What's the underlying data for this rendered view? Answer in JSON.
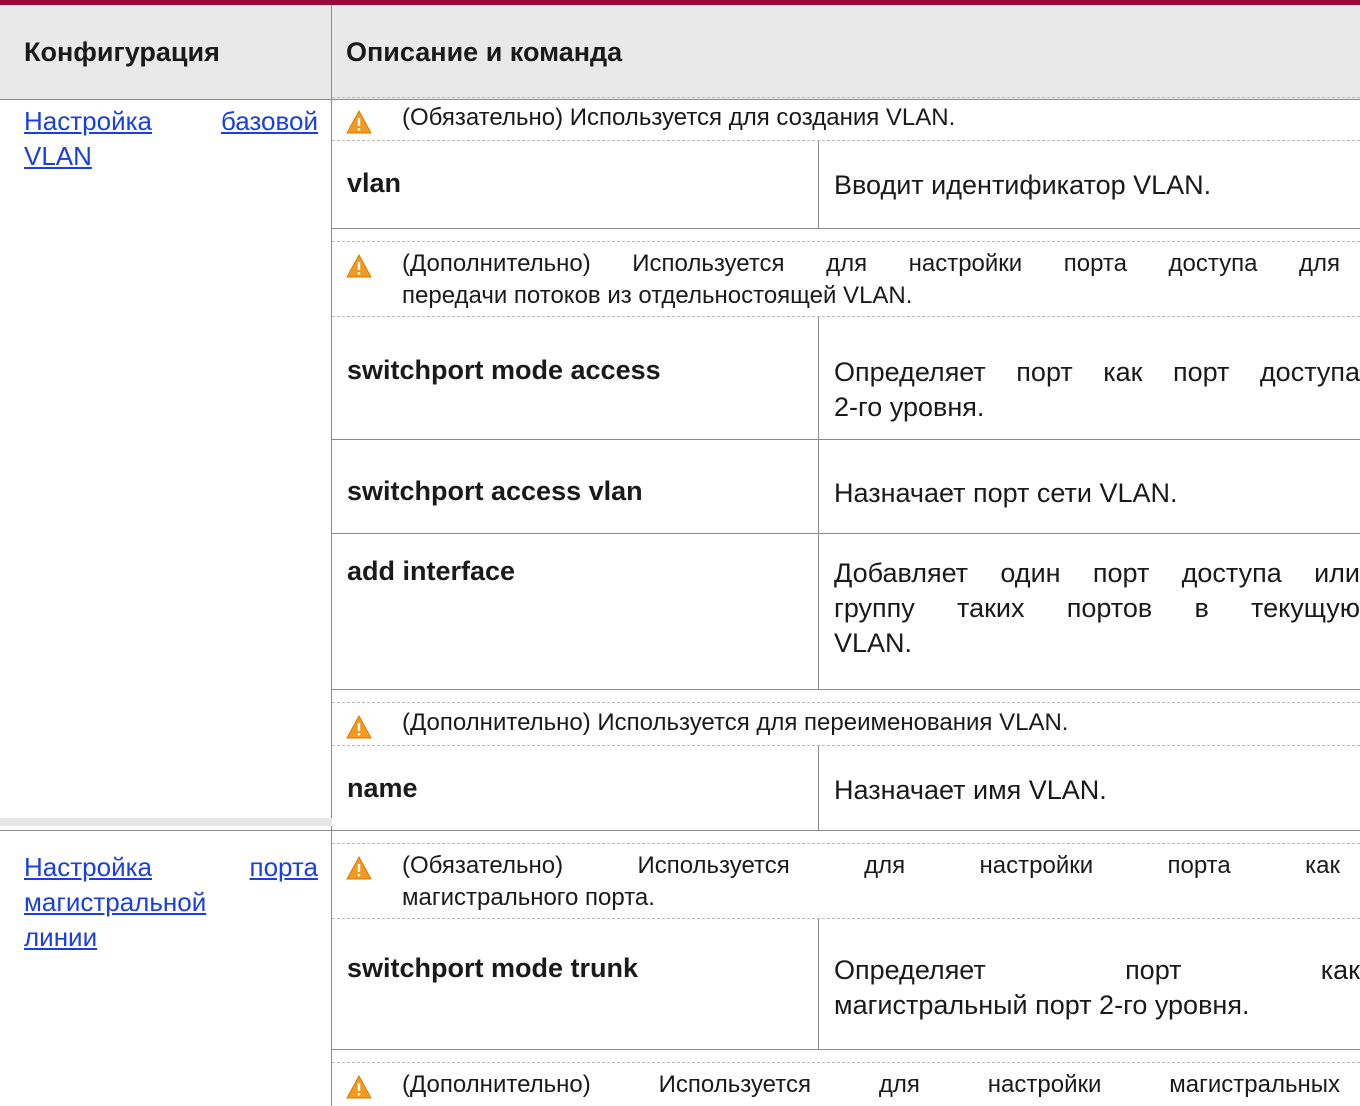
{
  "header": {
    "col1": "Конфигурация",
    "col2": "Описание и команда"
  },
  "sections": [
    {
      "link_lines": [
        [
          "Настройка",
          "базовой"
        ],
        [
          "VLAN"
        ]
      ],
      "items": [
        {
          "type": "note",
          "lines": [
            "(Обязательно) Используется для создания VLAN."
          ]
        },
        {
          "type": "cmd",
          "command": "vlan",
          "desc": [
            "Вводит идентификатор VLAN."
          ]
        },
        {
          "type": "note",
          "lines": [
            "(Дополнительно) Используется для настройки порта доступа для",
            "передачи потоков из отдельностоящей VLAN."
          ]
        },
        {
          "type": "cmd",
          "command": "switchport mode access",
          "desc": [
            "Определяет порт как порт доступа",
            "2-го уровня."
          ]
        },
        {
          "type": "cmd",
          "command": "switchport access vlan",
          "desc": [
            "Назначает порт сети VLAN."
          ]
        },
        {
          "type": "cmd",
          "command": "add interface",
          "desc": [
            "Добавляет один порт доступа или",
            "группу таких портов в текущую",
            "VLAN."
          ]
        },
        {
          "type": "note",
          "lines": [
            "(Дополнительно) Используется для переименования VLAN."
          ]
        },
        {
          "type": "cmd",
          "command": "name",
          "desc": [
            "Назначает имя VLAN."
          ]
        }
      ]
    },
    {
      "link_lines": [
        [
          "Настройка",
          "порта"
        ],
        [
          "магистральной"
        ],
        [
          "линии"
        ]
      ],
      "items": [
        {
          "type": "note",
          "lines": [
            "(Обязательно) Используется для настройки порта как",
            "магистрального порта."
          ]
        },
        {
          "type": "cmd",
          "command": "switchport mode trunk",
          "desc": [
            "Определяет порт как",
            "магистральный порт 2-го уровня."
          ]
        },
        {
          "type": "note",
          "lines": [
            "(Дополнительно) Используется для настройки магистральных"
          ]
        }
      ]
    }
  ]
}
